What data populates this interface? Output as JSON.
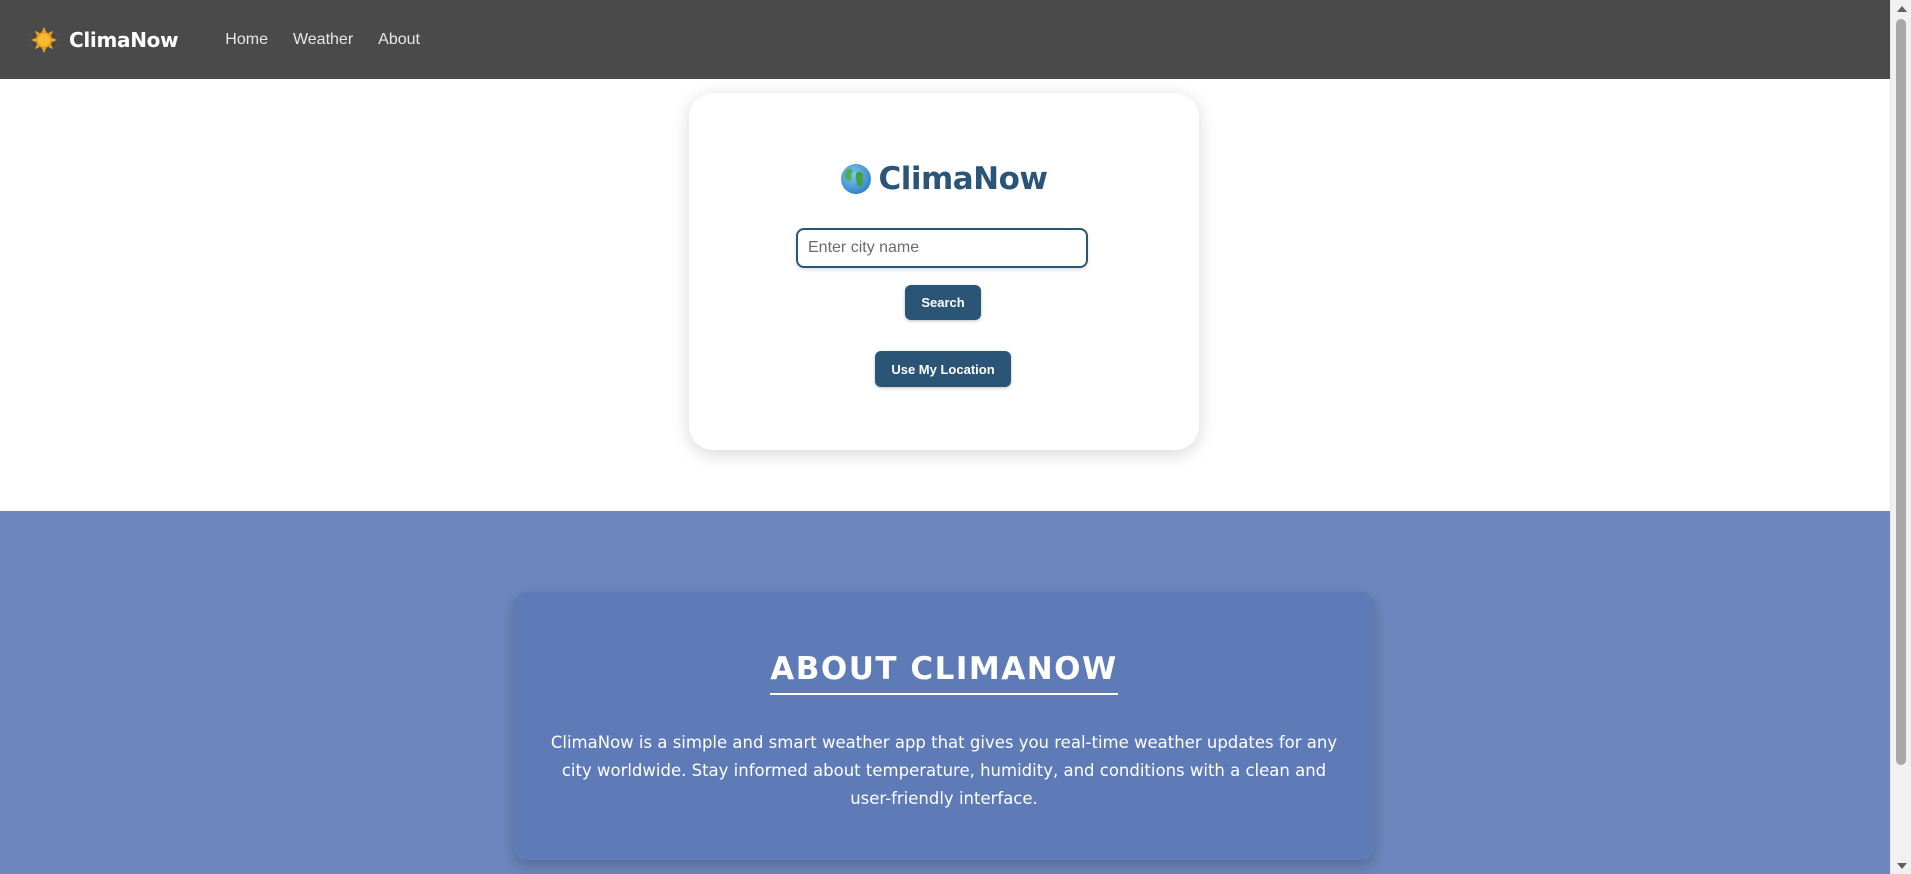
{
  "navbar": {
    "brand_icon": "sun-icon",
    "brand_name": "ClimaNow",
    "links": [
      {
        "label": "Home"
      },
      {
        "label": "Weather"
      },
      {
        "label": "About"
      }
    ]
  },
  "search_card": {
    "title_icon": "globe-icon",
    "title": "ClimaNow",
    "city_input": {
      "placeholder": "Enter city name",
      "value": ""
    },
    "search_label": "Search",
    "location_label": "Use My Location"
  },
  "about": {
    "title": "ABOUT CLIMANOW",
    "text": "ClimaNow is a simple and smart weather app that gives you real-time weather updates for any city worldwide. Stay informed about temperature, humidity, and conditions with a clean and user-friendly interface."
  },
  "colors": {
    "navbar": "#4a4a4a",
    "accent": "#2b5577",
    "about_bg": "#6d87be",
    "about_card": "#5e7bb8"
  }
}
